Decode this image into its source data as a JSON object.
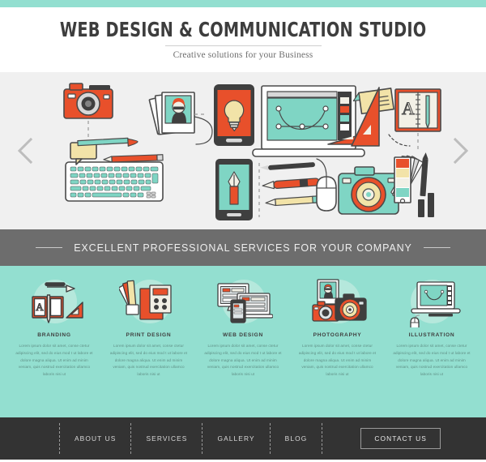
{
  "theme": {
    "teal": "#93dfd0",
    "teal_light": "#b5e8dc",
    "band_gray": "#6d6d6d",
    "footer_dark": "#333333",
    "banner_bg": "#f0f0f0",
    "accent_orange": "#e8502b",
    "ink": "#3d3d3d"
  },
  "header": {
    "title": "WEB DESIGN & COMMUNICATION STUDIO",
    "tagline": "Creative solutions for your Business"
  },
  "slider": {
    "prev_icon": "chevron-left-icon",
    "next_icon": "chevron-right-icon",
    "illustration_name": "design-workspace-illustration"
  },
  "band": {
    "text": "EXCELLENT PROFESSIONAL SERVICES FOR YOUR COMPANY"
  },
  "services": {
    "body_text": "Lorem ipsum dolor sit amet, conse ctetur adipiscing elit, sed do eius mod t ut labore et dolore magna aliqua. Ut enim ad minim veniam, quis nostrud exercitation ullamco laboris nisi ut",
    "items": [
      {
        "title": "BRANDING",
        "icon": "branding-icon"
      },
      {
        "title": "PRINT DESIGN",
        "icon": "print-design-icon"
      },
      {
        "title": "WEB DESIGN",
        "icon": "web-design-icon"
      },
      {
        "title": "PHOTOGRAPHY",
        "icon": "photography-icon"
      },
      {
        "title": "ILLUSTRATION",
        "icon": "illustration-icon"
      }
    ]
  },
  "footer": {
    "nav": [
      {
        "label": "ABOUT US"
      },
      {
        "label": "SERVICES"
      },
      {
        "label": "GALLERY"
      },
      {
        "label": "BLOG"
      }
    ],
    "contact_label": "CONTACT US"
  }
}
